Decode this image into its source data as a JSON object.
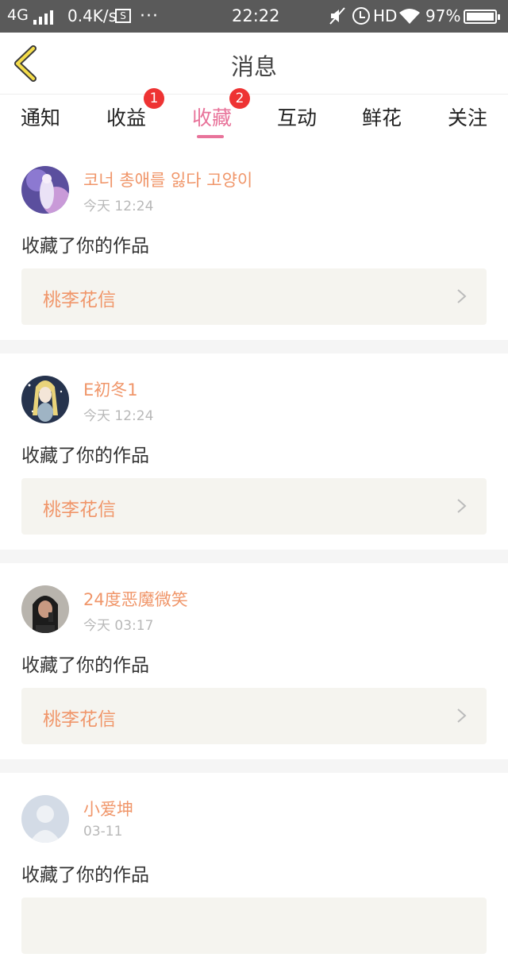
{
  "status_bar": {
    "network": "4G",
    "speed": "0.4K/s",
    "sim_label": "S",
    "dots": "···",
    "time": "22:22",
    "hd": "HD",
    "battery": "97%"
  },
  "header": {
    "title": "消息",
    "back_icon": "chevron-left-icon"
  },
  "tabs": [
    {
      "label": "通知"
    },
    {
      "label": "收益",
      "badge": "1"
    },
    {
      "label": "收藏",
      "badge": "2",
      "active": true
    },
    {
      "label": "互动"
    },
    {
      "label": "鲜花"
    },
    {
      "label": "关注"
    }
  ],
  "colors": {
    "accent": "#e8739a",
    "name": "#f0966a",
    "badge": "#ee3333",
    "card_bg": "#f5f4ef"
  },
  "messages": [
    {
      "username": "코너 총애를 잃다 고양이",
      "time": "今天 12:24",
      "action": "收藏了你的作品",
      "work": "桃李花信",
      "avatar": "avatar-anime-girl"
    },
    {
      "username": "E初冬1",
      "time": "今天 12:24",
      "action": "收藏了你的作品",
      "work": "桃李花信",
      "avatar": "avatar-blonde-character"
    },
    {
      "username": "24度恶魔微笑",
      "time": "今天 03:17",
      "action": "收藏了你的作品",
      "work": "桃李花信",
      "avatar": "avatar-photo"
    },
    {
      "username": "小爱坤",
      "time": "03-11",
      "action": "收藏了你的作品",
      "work": "",
      "avatar": "avatar-default"
    }
  ]
}
